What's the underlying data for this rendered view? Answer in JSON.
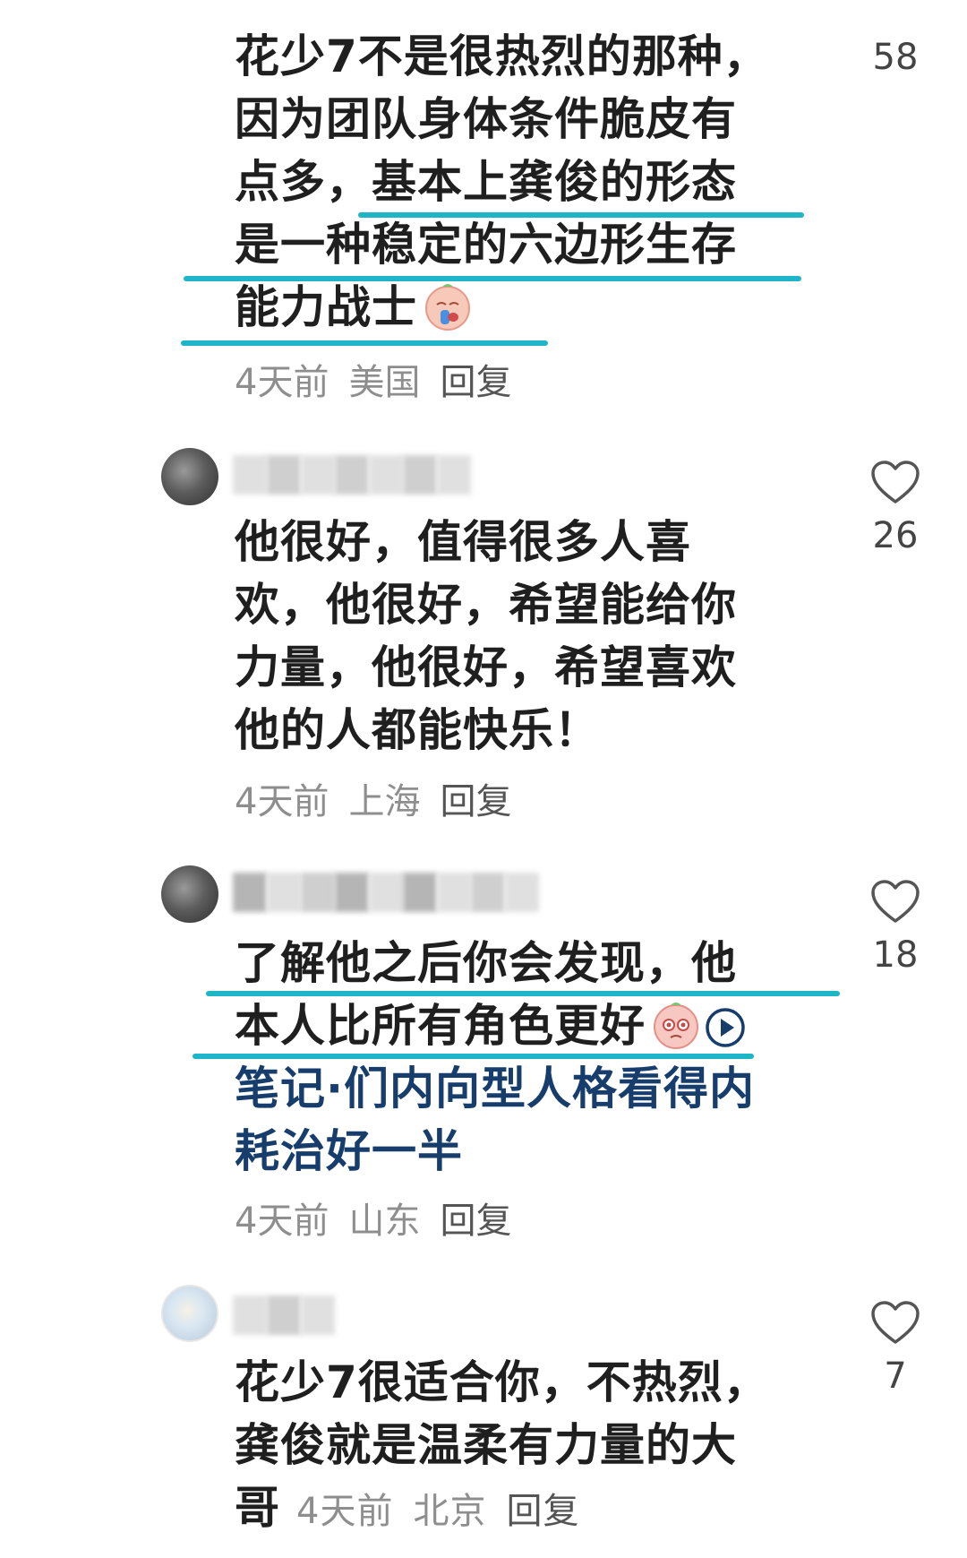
{
  "colors": {
    "text": "#1f1f1f",
    "meta": "#8e8e8e",
    "link": "#163d6c",
    "underline": "#1fb5c8",
    "heart_outline": "#555555"
  },
  "comments": [
    {
      "lines": [
        "花少7不是很热烈的那种，",
        "因为团队身体条件脆皮有",
        "点多，基本上龚俊的形态",
        "是一种稳定的六边形生存",
        "能力战士"
      ],
      "emoji": "crying-face-emoji",
      "time": "4天前",
      "location": "美国",
      "reply": "回复",
      "likes": "58"
    },
    {
      "lines": [
        "他很好，值得很多人喜",
        "欢，他很好，希望能给你",
        "力量，他很好，希望喜欢",
        "他的人都能快乐！"
      ],
      "time": "4天前",
      "location": "上海",
      "reply": "回复",
      "likes": "26"
    },
    {
      "lines": [
        "了解他之后你会发现，他",
        "本人比所有角色更好"
      ],
      "emoji": "pleading-face-emoji",
      "link_lines": [
        "笔记·们内向型人格看得内",
        "耗治好一半"
      ],
      "time": "4天前",
      "location": "山东",
      "reply": "回复",
      "likes": "18"
    },
    {
      "lines": [
        "花少7很适合你，不热烈，",
        "龚俊就是温柔有力量的大",
        "哥"
      ],
      "time": "4天前",
      "location": "北京",
      "reply": "回复",
      "likes": "7"
    }
  ]
}
